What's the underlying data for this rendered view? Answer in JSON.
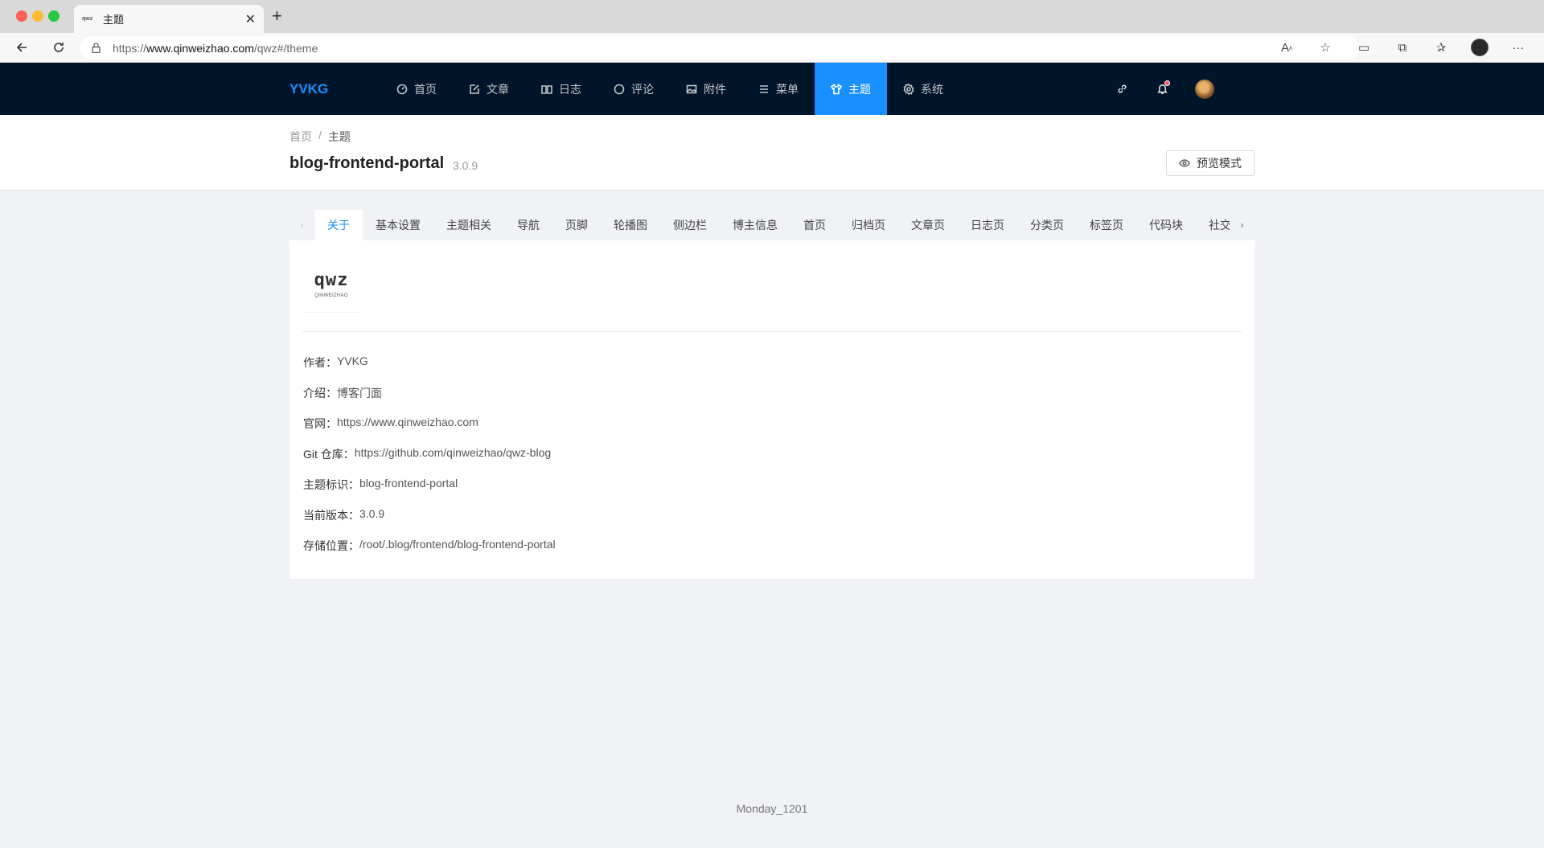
{
  "browser": {
    "tab_title": "主题",
    "favicon_text": "qwz",
    "url_prefix": "https://",
    "url_host": "www.qinweizhao.com",
    "url_path": "/qwz#/theme"
  },
  "header": {
    "brand": "YVKG",
    "menu": [
      {
        "label": "首页",
        "icon": "dashboard-icon"
      },
      {
        "label": "文章",
        "icon": "edit-icon"
      },
      {
        "label": "日志",
        "icon": "book-icon"
      },
      {
        "label": "评论",
        "icon": "comment-icon"
      },
      {
        "label": "附件",
        "icon": "picture-icon"
      },
      {
        "label": "菜单",
        "icon": "menu-icon"
      },
      {
        "label": "主题",
        "icon": "skin-icon",
        "active": true
      },
      {
        "label": "系统",
        "icon": "setting-icon"
      }
    ]
  },
  "page_header": {
    "breadcrumb": [
      "首页",
      "主题"
    ],
    "title": "blog-frontend-portal",
    "version": "3.0.9",
    "preview_button": "预览模式"
  },
  "tabs": [
    "关于",
    "基本设置",
    "主题相关",
    "导航",
    "页脚",
    "轮播图",
    "侧边栏",
    "博主信息",
    "首页",
    "归档页",
    "文章页",
    "日志页",
    "分类页",
    "标签页",
    "代码块",
    "社交"
  ],
  "active_tab": 0,
  "about": {
    "logo_main": "qwz",
    "logo_sub": "QINWEIZHAO",
    "rows": [
      {
        "label": "作者：",
        "value": "YVKG"
      },
      {
        "label": "介绍：",
        "value": "博客门面"
      },
      {
        "label": "官网：",
        "value": "https://www.qinweizhao.com"
      },
      {
        "label": "Git 仓库：",
        "value": "https://github.com/qinweizhao/qwz-blog"
      },
      {
        "label": "主题标识：",
        "value": "blog-frontend-portal"
      },
      {
        "label": "当前版本：",
        "value": "3.0.9"
      },
      {
        "label": "存储位置：",
        "value": "/root/.blog/frontend/blog-frontend-portal"
      }
    ]
  },
  "footer": "Monday_1201",
  "colors": {
    "primary": "#1890ff",
    "header_bg": "#001529",
    "page_bg": "#f0f2f5"
  }
}
